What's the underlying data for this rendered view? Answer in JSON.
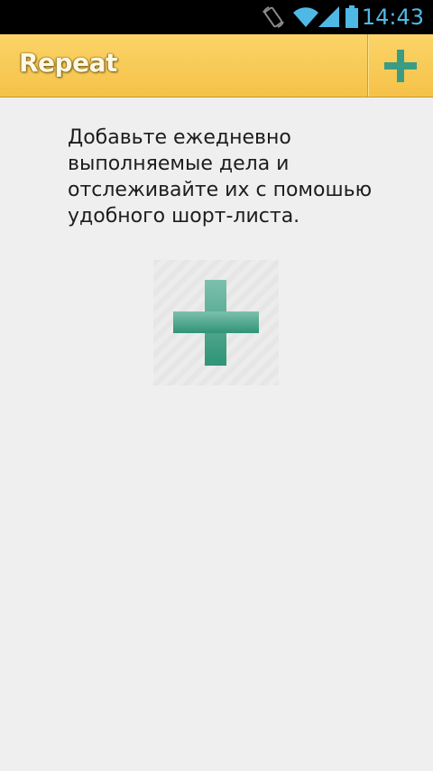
{
  "status_bar": {
    "time": "14:43",
    "icons": [
      "screen-rotation-icon",
      "wifi-icon",
      "signal-icon",
      "battery-icon"
    ]
  },
  "action_bar": {
    "title": "Repeat",
    "add_icon": "plus-icon"
  },
  "main": {
    "empty_hint": "Добавьте ежедневно выполняемые дела и отслеживайте их с помошью удобного шорт-листа.",
    "add_icon": "plus-icon"
  },
  "colors": {
    "action_bar": "#f8ca55",
    "accent_plus": "#3a9c84",
    "background": "#efefef",
    "clock": "#4fb9e6"
  }
}
